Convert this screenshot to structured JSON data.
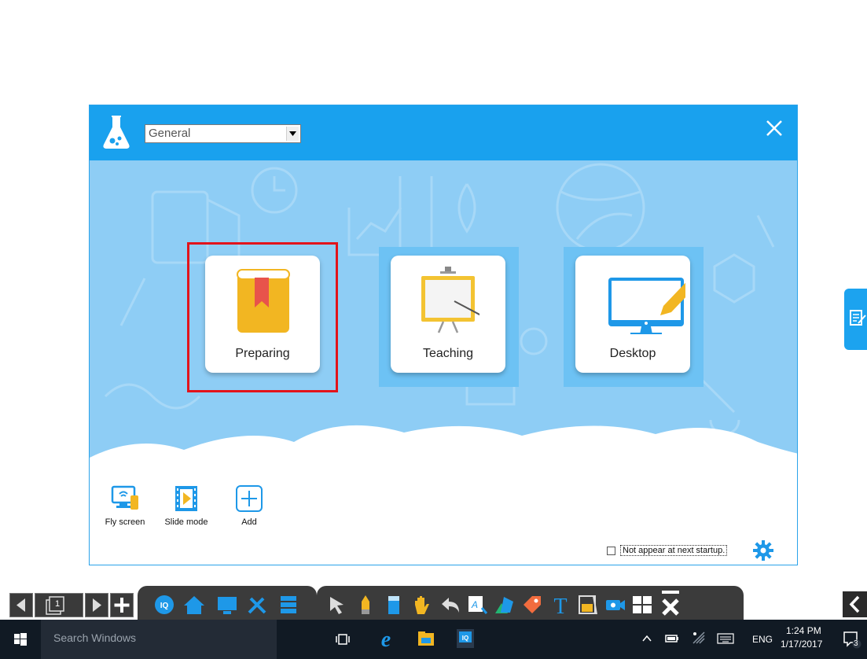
{
  "launcher": {
    "category_select": "General",
    "tiles": [
      {
        "label": "Preparing"
      },
      {
        "label": "Teaching"
      },
      {
        "label": "Desktop"
      }
    ],
    "shortcuts": [
      {
        "label": "Fly screen"
      },
      {
        "label": "Slide mode"
      },
      {
        "label": "Add"
      }
    ],
    "startup_option": "Not appear at next startup."
  },
  "board_toolbar": {
    "page_number": "1"
  },
  "taskbar": {
    "search_placeholder": "Search Windows",
    "language": "ENG",
    "time": "1:24 PM",
    "date": "1/17/2017",
    "notification_count": "3"
  },
  "colors": {
    "title_bar": "#19a1ee",
    "window_bg": "#8ecdf5",
    "selection": "#e2131b",
    "taskbar": "#111a24"
  }
}
